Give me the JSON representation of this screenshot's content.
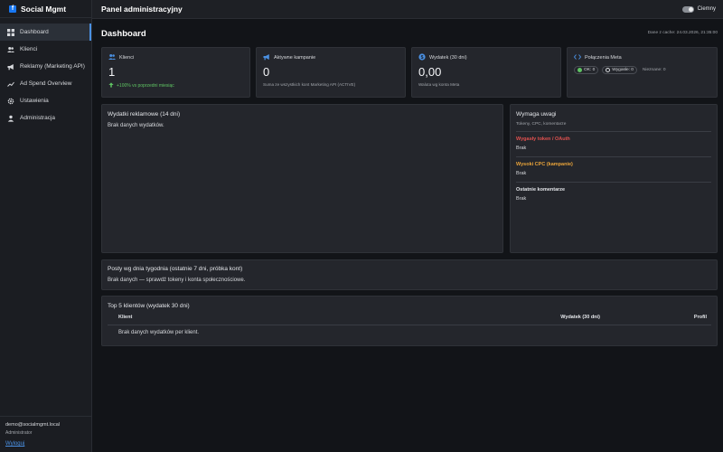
{
  "app": {
    "brand": "Social Mgmt"
  },
  "sidebar": {
    "items": [
      {
        "label": "Dashboard",
        "icon": "grid-icon"
      },
      {
        "label": "Klienci",
        "icon": "users-icon"
      },
      {
        "label": "Reklamy (Marketing API)",
        "icon": "megaphone-icon"
      },
      {
        "label": "Ad Spend Overview",
        "icon": "trending-icon"
      },
      {
        "label": "Ustawienia",
        "icon": "gear-icon"
      },
      {
        "label": "Administracja",
        "icon": "admin-icon"
      }
    ],
    "footer": {
      "email": "demo@socialmgmt.local",
      "role": "Administrator",
      "logout": "Wyloguj"
    }
  },
  "topbar": {
    "title": "Panel administracyjny",
    "theme_label": "Ciemny"
  },
  "page": {
    "title": "Dashboard",
    "cache_date": "Dane z cache: 24.03.2026, 21:35:00"
  },
  "stats": {
    "clients": {
      "label": "Klienci",
      "value": "1",
      "trend": "+100% vs poprzedni miesiąc"
    },
    "campaigns": {
      "label": "Aktywne kampanie",
      "value": "0",
      "note": "Suma ze wszystkich kont Marketing API (ACTIVE)"
    },
    "spend": {
      "label": "Wydatek (30 dni)",
      "value": "0,00",
      "note": "Waluta wg konta Meta"
    },
    "meta": {
      "label": "Połączenia Meta",
      "ok": "OK: 0",
      "expired": "Wygasłe: 0",
      "unknown": "Nieznane: 0"
    }
  },
  "ad_spend": {
    "title": "Wydatki reklamowe (14 dni)",
    "empty": "Brak danych wydatków."
  },
  "attention": {
    "title": "Wymaga uwagi",
    "subtitle": "Tokeny, CPC, komentarze",
    "items": [
      {
        "title": "Wygasły token / OAuth",
        "value": "Brak",
        "color": "#e0514f"
      },
      {
        "title": "Wysoki CPC (kampanie)",
        "value": "Brak",
        "color": "#e8a33a"
      },
      {
        "title": "Ostatnie komentarze",
        "value": "Brak",
        "color": "#e4e6ea"
      }
    ]
  },
  "posts": {
    "title": "Posty wg dnia tygodnia (ostatnie 7 dni, próbka kont)",
    "empty": "Brak danych — sprawdź tokeny i konta społecznościowe."
  },
  "top_clients": {
    "title": "Top 5 klientów (wydatek 30 dni)",
    "columns": [
      "Klient",
      "Wydatek (30 dni)",
      "Profil"
    ],
    "empty": "Brak danych wydatków per klient."
  },
  "colors": {
    "accent": "#4a90e2",
    "positive": "#5fc463",
    "danger": "#e0514f",
    "warning": "#e8a33a",
    "brand": "#1877f2"
  }
}
